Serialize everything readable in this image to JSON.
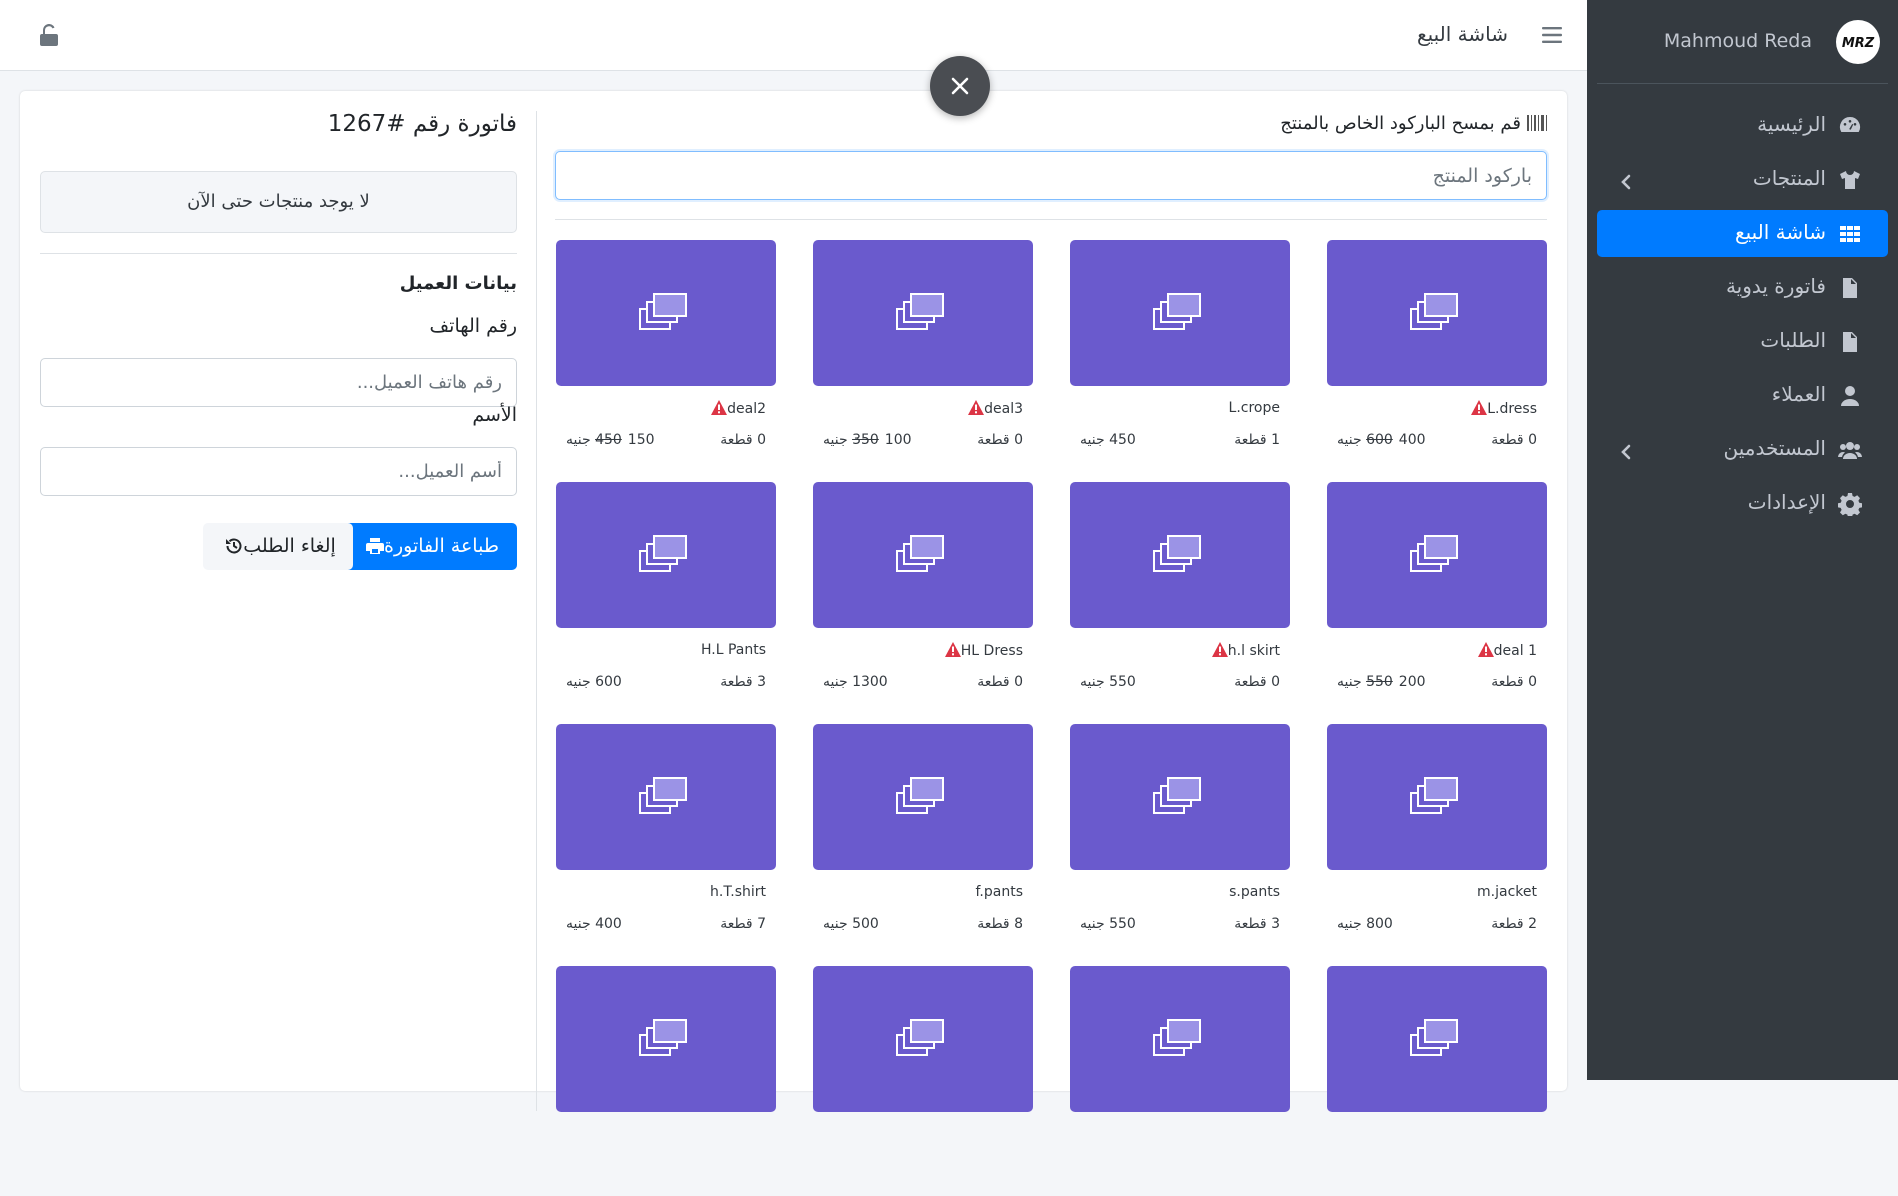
{
  "sidebar": {
    "user_name": "Mahmoud Reda",
    "avatar_text": "MRZ",
    "items": [
      {
        "label": "الرئيسية",
        "icon": "dashboard-icon"
      },
      {
        "label": "المنتجات",
        "icon": "tshirt-icon",
        "has_submenu": true
      },
      {
        "label": "شاشة البيع",
        "icon": "grid-icon",
        "active": true
      },
      {
        "label": "فاتورة يدوية",
        "icon": "file-icon"
      },
      {
        "label": "الطلبات",
        "icon": "file-invoice-icon"
      },
      {
        "label": "العملاء",
        "icon": "user-icon"
      },
      {
        "label": "المستخدمين",
        "icon": "users-icon",
        "has_submenu": true
      },
      {
        "label": "الإعدادات",
        "icon": "gear-icon"
      }
    ]
  },
  "topbar": {
    "title": "شاشة البيع"
  },
  "colors": {
    "accent": "#007bff",
    "sidebar_bg": "#343a40",
    "tile_bg": "#6a5acd",
    "warning": "#dc3545"
  },
  "products": {
    "barcode_label": "قم بمسح الباركود الخاص بالمنتج",
    "barcode_placeholder": "باركود المنتج",
    "items": [
      {
        "name": "L.dress",
        "warn": true,
        "qty": "0 قطعة",
        "price": "400 جنيه",
        "old_price": "600"
      },
      {
        "name": "L.crope",
        "warn": false,
        "qty": "1 قطعة",
        "price": "450 جنيه",
        "old_price": ""
      },
      {
        "name": "deal3",
        "warn": true,
        "qty": "0 قطعة",
        "price": "100 جنيه",
        "old_price": "350"
      },
      {
        "name": "deal2",
        "warn": true,
        "qty": "0 قطعة",
        "price": "150 جنيه",
        "old_price": "450"
      },
      {
        "name": "deal 1",
        "warn": true,
        "qty": "0 قطعة",
        "price": "200 جنيه",
        "old_price": "550"
      },
      {
        "name": "h.l skirt",
        "warn": true,
        "qty": "0 قطعة",
        "price": "550 جنيه",
        "old_price": ""
      },
      {
        "name": "HL Dress",
        "warn": true,
        "qty": "0 قطعة",
        "price": "1300 جنيه",
        "old_price": ""
      },
      {
        "name": "H.L Pants",
        "warn": false,
        "qty": "3 قطعة",
        "price": "600 جنيه",
        "old_price": ""
      },
      {
        "name": "m.jacket",
        "warn": false,
        "qty": "2 قطعة",
        "price": "800 جنيه",
        "old_price": ""
      },
      {
        "name": "s.pants",
        "warn": false,
        "qty": "3 قطعة",
        "price": "550 جنيه",
        "old_price": ""
      },
      {
        "name": "f.pants",
        "warn": false,
        "qty": "8 قطعة",
        "price": "500 جنيه",
        "old_price": ""
      },
      {
        "name": "h.T.shirt",
        "warn": false,
        "qty": "7 قطعة",
        "price": "400 جنيه",
        "old_price": ""
      },
      {
        "name": "",
        "warn": false,
        "qty": "",
        "price": "",
        "old_price": ""
      },
      {
        "name": "",
        "warn": false,
        "qty": "",
        "price": "",
        "old_price": ""
      },
      {
        "name": "",
        "warn": false,
        "qty": "",
        "price": "",
        "old_price": ""
      },
      {
        "name": "",
        "warn": false,
        "qty": "",
        "price": "",
        "old_price": ""
      }
    ]
  },
  "invoice": {
    "title": "فاتورة رقم #1267",
    "empty_text": "لا يوجد منتجات حتى الآن",
    "customer_section": "بيانات العميل",
    "phone_label": "رقم الهاتف",
    "phone_placeholder": "رقم هاتف العميل...",
    "name_label": "الأسم",
    "name_placeholder": "أسم العميل...",
    "print_button": "طباعة الفاتورة",
    "cancel_button": "إلغاء الطلب"
  }
}
